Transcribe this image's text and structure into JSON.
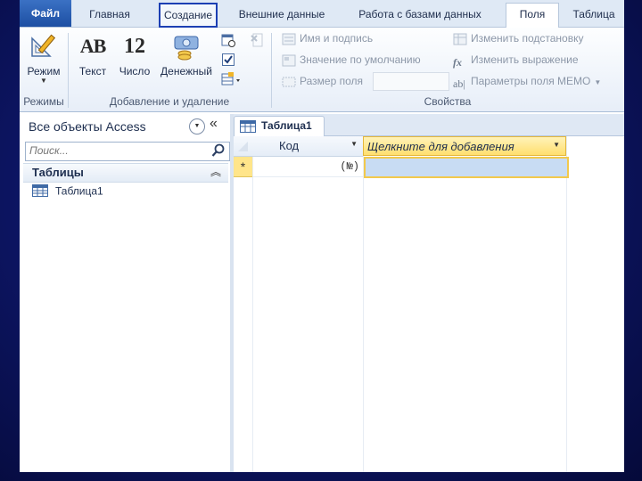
{
  "ribbon_tabs": {
    "file": "Файл",
    "home": "Главная",
    "create": "Создание",
    "external": "Внешние данные",
    "database_tools": "Работа с базами данных",
    "fields": "Поля",
    "table": "Таблица"
  },
  "ribbon": {
    "view_button": "Режим",
    "text_button": "Текст",
    "number_button": "Число",
    "currency_button": "Денежный",
    "text_icon_glyph": "AB",
    "number_icon_glyph": "12",
    "name_caption": "Имя и подпись",
    "default_value": "Значение по умолчанию",
    "field_size": "Размер поля",
    "modify_lookups": "Изменить подстановку",
    "modify_expression": "Изменить выражение",
    "memo_settings": "Параметры поля MEMO",
    "groups": {
      "views": "Режимы",
      "add_delete": "Добавление и удаление",
      "properties": "Свойства"
    }
  },
  "nav": {
    "title": "Все объекты Access",
    "search_placeholder": "Поиск...",
    "group_label": "Таблицы",
    "items": [
      "Таблица1"
    ]
  },
  "document": {
    "tab_label": "Таблица1",
    "columns": [
      "Код",
      "Щелкните для добавления"
    ],
    "new_row_marker": "*",
    "new_row_id": "(№)"
  },
  "colors": {
    "accent_blue": "#1c3fb3",
    "selected_cell": "#c8dcf3",
    "header_highlight": "#ffd84a"
  }
}
